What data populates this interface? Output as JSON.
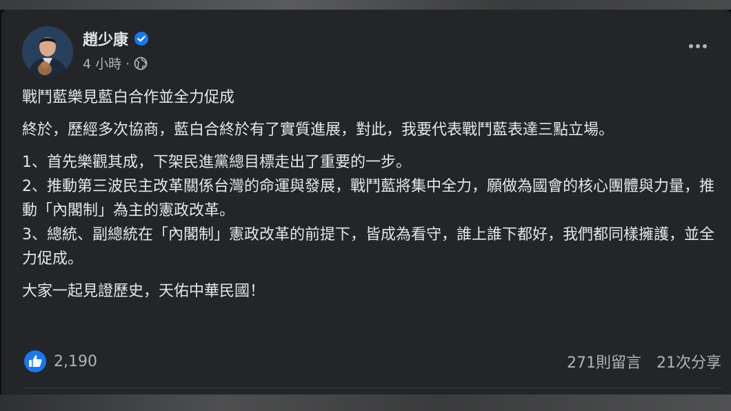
{
  "post": {
    "author": "趙少康",
    "timestamp": "4 小時 ·",
    "title": "戰鬥藍樂見藍白合作並全力促成",
    "paragraph1": "終於，歷經多次協商，藍白合終於有了實質進展，對此，我要代表戰鬥藍表達三點立場。",
    "point1": "1、首先樂觀其成，下架民進黨總目標走出了重要的一步。",
    "point2": "2、推動第三波民主改革關係台灣的命運與發展，戰鬥藍將集中全力，願做為國會的核心團體與力量，推動「內閣制」為主的憲政改革。",
    "point3": "3、總統、副總統在「內閣制」憲政改革的前提下，皆成為看守，誰上誰下都好，我們都同樣擁護，並全力促成。",
    "closing": "大家一起見證歷史，天佑中華民國！"
  },
  "stats": {
    "likes": "2,190",
    "comments": "271則留言",
    "shares": "21次分享"
  },
  "colors": {
    "card": "#242526",
    "text": "#e4e6eb",
    "secondary": "#b0b3b8",
    "accent": "#1877f2"
  }
}
